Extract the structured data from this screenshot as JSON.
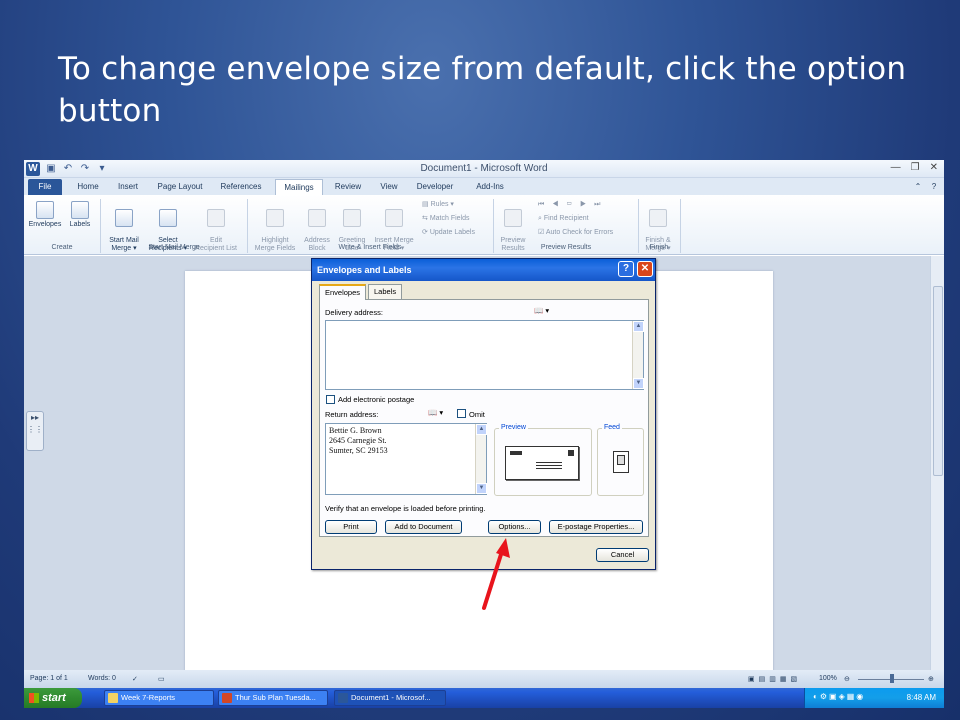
{
  "slide": {
    "title": "To change envelope size from default, click the option button"
  },
  "word": {
    "title": "Document1 - Microsoft Word",
    "tabs": [
      "File",
      "Home",
      "Insert",
      "Page Layout",
      "References",
      "Mailings",
      "Review",
      "View",
      "Developer",
      "Add-Ins"
    ],
    "active_tab": "Mailings",
    "ribbon": {
      "create": {
        "label": "Create",
        "envelopes": "Envelopes",
        "labels": "Labels"
      },
      "start_mail_merge": {
        "label": "Start Mail Merge",
        "start": "Start Mail\nMerge ▾",
        "select": "Select\nRecipients ▾",
        "edit": "Edit\nRecipient List"
      },
      "write_insert": {
        "label": "Write & Insert Fields",
        "highlight": "Highlight\nMerge Fields",
        "address": "Address\nBlock",
        "greeting": "Greeting\nLine",
        "insert_merge": "Insert Merge\nField ▾",
        "rules": "Rules ▾",
        "match": "Match Fields",
        "update": "Update Labels"
      },
      "preview": {
        "label": "Preview Results",
        "preview": "Preview\nResults",
        "find": "Find Recipient",
        "auto_check": "Auto Check for Errors"
      },
      "finish": {
        "label": "Finish",
        "finish": "Finish &\nMerge ▾"
      }
    },
    "status": {
      "page": "Page: 1 of 1",
      "words": "Words: 0",
      "zoom": "100%"
    }
  },
  "dialog": {
    "title": "Envelopes and Labels",
    "help": "?",
    "close": "✕",
    "tabs": [
      "Envelopes",
      "Labels"
    ],
    "delivery_label": "Delivery address:",
    "add_postage": "Add electronic postage",
    "return_label": "Return address:",
    "omit": "Omit",
    "return_address": [
      "Bettie G. Brown",
      "2645 Carnegie St.",
      "Sumter, SC 29153"
    ],
    "preview_label": "Preview",
    "feed_label": "Feed",
    "verify_text": "Verify that an envelope is loaded before printing.",
    "buttons": {
      "print": "Print",
      "add_to_document": "Add to Document",
      "options": "Options...",
      "epostage": "E-postage Properties...",
      "cancel": "Cancel"
    }
  },
  "taskbar": {
    "start": "start",
    "items": [
      "Week 7-Reports",
      "Thur Sub Plan Tuesda...",
      "Document1 - Microsof..."
    ],
    "clock": "8:48 AM"
  },
  "colors": {
    "arrow": "#e8141c",
    "slide_bg": "#2f5496",
    "dialog_title": "#0a5fd8"
  }
}
